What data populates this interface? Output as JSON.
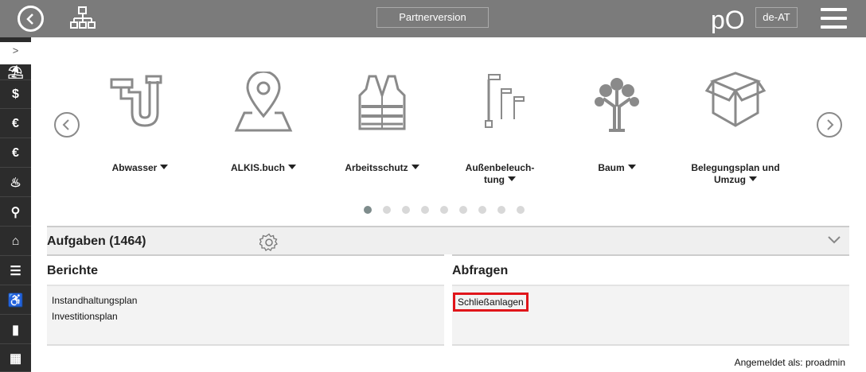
{
  "header": {
    "back_icon": "back-circle-icon",
    "sitemap_icon": "sitemap-icon",
    "partner_label": "Partnerversion",
    "logo_text": "pO",
    "language": "de-AT",
    "menu_icon": "hamburger-icon"
  },
  "sidebar": {
    "toggle_label": ">",
    "items": [
      {
        "icon": "person-desk-icon",
        "glyph": "⛱"
      },
      {
        "icon": "dollar-icon",
        "glyph": "$"
      },
      {
        "icon": "euro-arrows-icon",
        "glyph": "€"
      },
      {
        "icon": "euro-search-icon",
        "glyph": "€"
      },
      {
        "icon": "flame-icon",
        "glyph": "♨"
      },
      {
        "icon": "satellite-icon",
        "glyph": "⚲"
      },
      {
        "icon": "house-icon",
        "glyph": "⌂"
      },
      {
        "icon": "list-icon",
        "glyph": "☰"
      },
      {
        "icon": "chair-icon",
        "glyph": "♿"
      },
      {
        "icon": "extinguisher-icon",
        "glyph": "▮"
      },
      {
        "icon": "map-icon",
        "glyph": "▦"
      }
    ]
  },
  "carousel": {
    "categories": [
      {
        "label": "Abwasser",
        "icon": "pipe-icon"
      },
      {
        "label": "ALKIS.buch",
        "icon": "map-pin-icon"
      },
      {
        "label": "Arbeitsschutz",
        "icon": "safety-vest-icon"
      },
      {
        "label_line1": "Außenbeleuch-",
        "label_line2": "tung",
        "icon": "street-light-icon"
      },
      {
        "label": "Baum",
        "icon": "tree-icon"
      },
      {
        "label_line1": "Belegungsplan und",
        "label_line2": "Umzug",
        "icon": "box-icon"
      }
    ],
    "page_count": 9,
    "active_page": 1
  },
  "aufgaben": {
    "title": "Aufgaben (1464)"
  },
  "berichte": {
    "title": "Berichte",
    "items": [
      "Instandhaltungsplan",
      "Investitionsplan"
    ]
  },
  "abfragen": {
    "title": "Abfragen",
    "items": [
      "Schließanlagen"
    ]
  },
  "footer": {
    "login_text": "Angemeldet als: proadmin"
  },
  "colors": {
    "topbar": "#7b7b7b",
    "sidebar": "#2c2c2c",
    "highlight": "#e0151a",
    "icon_gray": "#8a8a8a"
  }
}
